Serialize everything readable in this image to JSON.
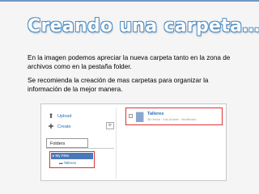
{
  "title": "Creando una carpeta…",
  "paragraphs": {
    "p1": "En la imagen podemos apreciar la nueva carpeta tanto en la zona de archivos como en la pestaña folder.",
    "p2": "Se recomienda la creación de mas carpetas para organizar la información de la mejor manera."
  },
  "screenshot": {
    "upload_label": "Upload",
    "create_label": "Create",
    "folders_tab": "Folders",
    "tree_root": "▸ My Files",
    "tree_child": "Talleres",
    "file_name": "Talleres",
    "file_meta": "Sin fecha · Edu Andrés · Modificado",
    "icons": {
      "upload": "upload-arrow-icon",
      "create": "plus-icon",
      "settings": "gear-icon",
      "folder": "folder-icon"
    }
  },
  "colors": {
    "title_outline": "#4f8fc6",
    "highlight": "#dd3333",
    "link": "#2a6db5",
    "selected_row": "#4a79b8"
  }
}
